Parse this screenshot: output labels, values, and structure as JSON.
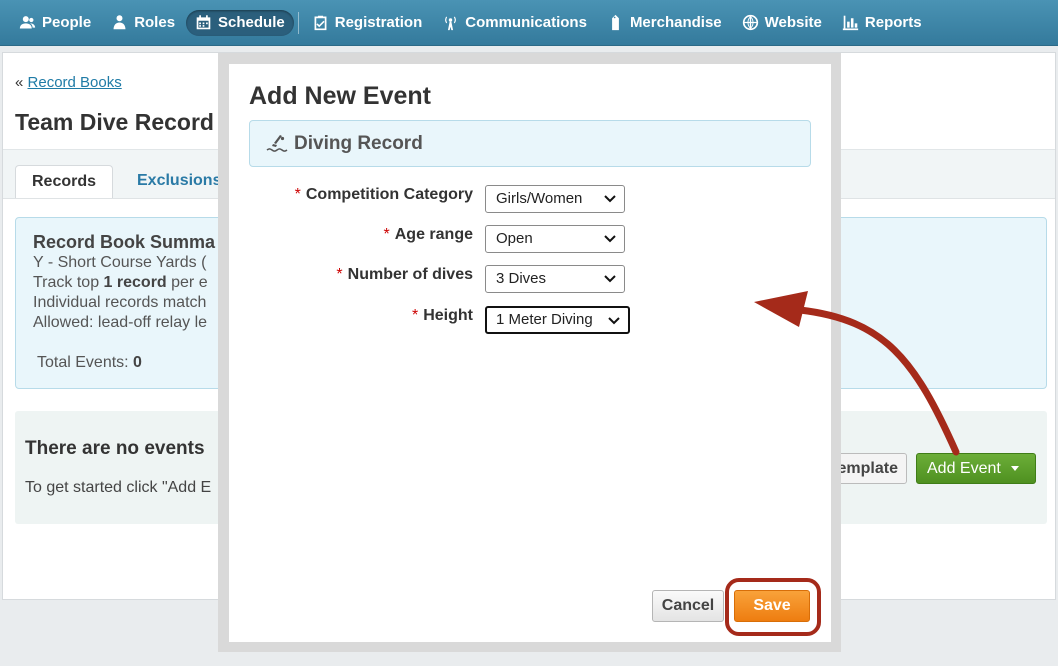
{
  "nav": {
    "items": [
      {
        "label": "People",
        "icon": "people-icon"
      },
      {
        "label": "Roles",
        "icon": "roles-icon"
      },
      {
        "label": "Schedule",
        "icon": "calendar-icon",
        "active": true
      },
      {
        "label": "Registration",
        "icon": "clipboard-check-icon"
      },
      {
        "label": "Communications",
        "icon": "broadcast-icon"
      },
      {
        "label": "Merchandise",
        "icon": "price-tag-icon"
      },
      {
        "label": "Website",
        "icon": "globe-icon"
      },
      {
        "label": "Reports",
        "icon": "bar-chart-icon"
      }
    ]
  },
  "page": {
    "crumb_prefix": "«",
    "crumb_link": "Record Books",
    "title": "Team Dive Record",
    "tabs": [
      {
        "label": "Records",
        "active": true
      },
      {
        "label": "Exclusions"
      }
    ],
    "summary": {
      "title": "Record Book Summa",
      "line1": "Y - Short Course Yards (",
      "line2_pre": "Track top ",
      "line2_bold": "1 record",
      "line2_post": " per e",
      "line3": "Individual records match",
      "line4": "Allowed: lead-off relay le",
      "total_label": "Total Events: ",
      "total_value": "0"
    },
    "empty": {
      "title": "There are no events",
      "text": "To get started click \"Add E"
    },
    "template_button": "emplate",
    "add_event_button": "Add Event"
  },
  "modal": {
    "title": "Add New Event",
    "type_label": "Diving Record",
    "fields": [
      {
        "label": "Competition Category",
        "value": "Girls/Women",
        "required": true
      },
      {
        "label": "Age range",
        "value": "Open",
        "required": true
      },
      {
        "label": "Number of dives",
        "value": "3 Dives",
        "required": true
      },
      {
        "label": "Height",
        "value": "1 Meter Diving",
        "required": true
      }
    ],
    "required_mark": "*",
    "cancel": "Cancel",
    "save": "Save"
  },
  "colors": {
    "nav": "#3a84a6",
    "accent_green": "#5a9c2b",
    "save_orange": "#f28a1e",
    "annotation": "#a52a1a"
  }
}
